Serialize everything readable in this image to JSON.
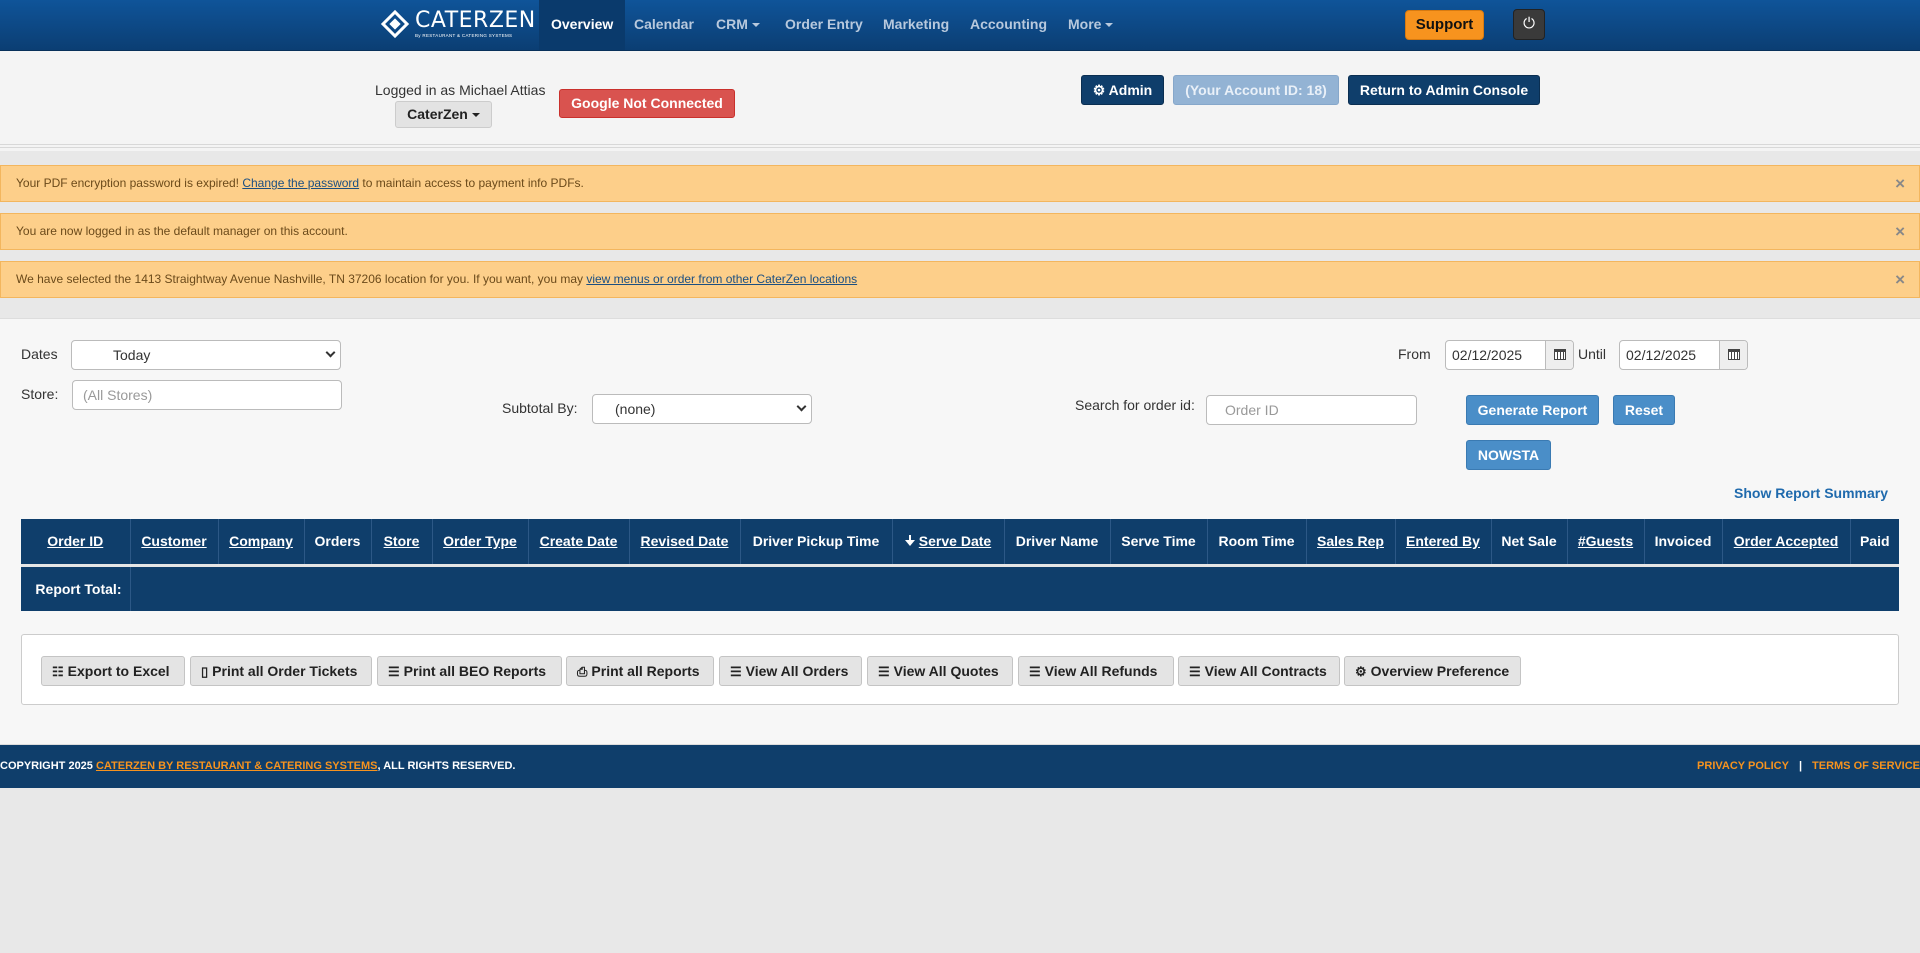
{
  "nav": {
    "logo_name": "CATERZEN",
    "logo_sub": "By RESTAURANT & CATERING SYSTEMS",
    "items": [
      {
        "label": "Overview"
      },
      {
        "label": "Calendar"
      },
      {
        "label": "CRM"
      },
      {
        "label": "Order Entry"
      },
      {
        "label": "Marketing"
      },
      {
        "label": "Accounting"
      },
      {
        "label": "More"
      }
    ],
    "support_label": "Support",
    "power_icon": "⏻"
  },
  "header": {
    "logged_in_text": "Logged in as Michael Attias",
    "store_label": "CaterZen",
    "google_label": "Google Not Connected",
    "admin_label": "⚙ Admin",
    "account_label": "(Your Account ID: 18)",
    "return_label": "Return to Admin Console"
  },
  "alerts": [
    {
      "pre": "Your PDF encryption password is expired! ",
      "link": "Change the password",
      "post": " to maintain access to payment info PDFs."
    },
    {
      "pre": "You are now logged in as the default manager on this account.",
      "link": "",
      "post": ""
    },
    {
      "pre": "We have selected the 1413 Straightway Avenue Nashville, TN 37206 location for you. If you want, you may ",
      "link": "view menus or order from other CaterZen locations",
      "post": ""
    }
  ],
  "close_glyph": "×",
  "filters": {
    "dates_label": "Dates",
    "dates_value": "Today",
    "store_label": "Store:",
    "store_placeholder": "(All Stores)",
    "subtotal_label": "Subtotal By:",
    "subtotal_value": "(none)",
    "from_label": "From",
    "from_value": "02/12/2025",
    "until_label": "Until",
    "until_value": "02/12/2025",
    "search_label": "Search for order id:",
    "order_placeholder": "Order ID",
    "generate_label": "Generate Report",
    "reset_label": "Reset",
    "nowsta_label": "NOWSTA",
    "summary_label": "Show Report Summary"
  },
  "table": {
    "columns": [
      {
        "label": "Order ID",
        "link": true
      },
      {
        "label": "Customer",
        "link": true
      },
      {
        "label": "Company",
        "link": true
      },
      {
        "label": "Orders",
        "link": false
      },
      {
        "label": "Store",
        "link": true
      },
      {
        "label": "Order Type",
        "link": true
      },
      {
        "label": "Create Date",
        "link": true
      },
      {
        "label": "Revised Date",
        "link": true
      },
      {
        "label": "Driver Pickup Time",
        "link": false
      },
      {
        "label": "Serve Date",
        "link": true,
        "sorted": true
      },
      {
        "label": "Driver Name",
        "link": false
      },
      {
        "label": "Serve Time",
        "link": false
      },
      {
        "label": "Room Time",
        "link": false
      },
      {
        "label": "Sales Rep",
        "link": true
      },
      {
        "label": "Entered By",
        "link": true
      },
      {
        "label": "Net Sale",
        "link": false
      },
      {
        "label": "#Guests",
        "link": true
      },
      {
        "label": "Invoiced",
        "link": false
      },
      {
        "label": "Order Accepted",
        "link": true
      },
      {
        "label": "Paid",
        "link": false
      }
    ],
    "total_label": "Report Total:"
  },
  "actions": [
    {
      "label": "Export to Excel",
      "icon": "grid-icon",
      "glyph": "☷"
    },
    {
      "label": "Print all Order Tickets",
      "icon": "mobile-icon",
      "glyph": "▯"
    },
    {
      "label": "Print all BEO Reports",
      "icon": "list-icon",
      "glyph": "☰"
    },
    {
      "label": "Print all Reports",
      "icon": "print-icon",
      "glyph": "⎙"
    },
    {
      "label": "View All Orders",
      "icon": "list-icon",
      "glyph": "☰"
    },
    {
      "label": "View All Quotes",
      "icon": "list-icon",
      "glyph": "☰"
    },
    {
      "label": "View All Refunds",
      "icon": "list-icon",
      "glyph": "☰"
    },
    {
      "label": "View All Contracts",
      "icon": "list-icon",
      "glyph": "☰"
    },
    {
      "label": "Overview Preference",
      "icon": "gear-icon",
      "glyph": "⚙"
    }
  ],
  "footer": {
    "prefix": "COPYRIGHT 2025 ",
    "company_link": "CATERZEN BY RESTAURANT & CATERING SYSTEMS",
    "suffix": ", ALL RIGHTS RESERVED.",
    "privacy": "PRIVACY POLICY",
    "divider": "|",
    "terms": "TERMS OF SERVICE"
  },
  "colors": {
    "nav_bg": "#0b3e73",
    "table_bg": "#0f3e6b",
    "support": "#f7931e",
    "danger": "#d9534f",
    "alert_bg": "#fdcf8a",
    "primary_btn": "#4a8ec8"
  }
}
